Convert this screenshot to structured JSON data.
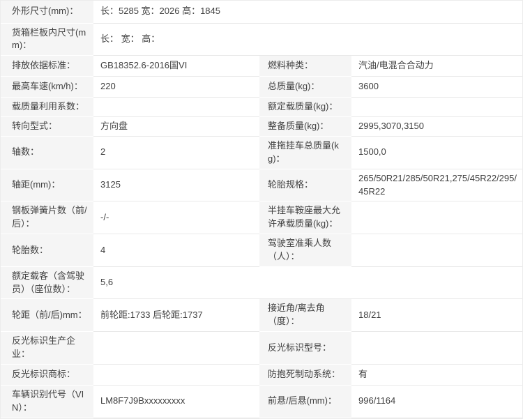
{
  "colors": {
    "label_bg": "#f5f5f5",
    "row_border": "#e9e9e9",
    "label_divider": "#ffffff",
    "text": "#404040",
    "page_bg": "#ffffff",
    "outer_border": "#ececec"
  },
  "table": {
    "name": "vehicle-specification-table",
    "rows": [
      {
        "kind": "full",
        "label": "外形尺寸(mm)：",
        "value": "长：5285 宽：2026 高：1845"
      },
      {
        "kind": "full",
        "label": "货箱栏板内尺寸(mm)：",
        "value": "长： 宽： 高："
      },
      {
        "kind": "split",
        "l_label": "排放依据标准：",
        "l_value": "GB18352.6-2016国VI",
        "r_label": "燃料种类：",
        "r_value": "汽油/电混合合动力"
      },
      {
        "kind": "split",
        "l_label": "最高车速(km/h)：",
        "l_value": "220",
        "r_label": "总质量(kg)：",
        "r_value": "3600"
      },
      {
        "kind": "split",
        "l_label": "载质量利用系数：",
        "l_value": "",
        "r_label": "额定载质量(kg)：",
        "r_value": ""
      },
      {
        "kind": "split",
        "l_label": "转向型式：",
        "l_value": "方向盘",
        "r_label": "整备质量(kg)：",
        "r_value": "2995,3070,3150"
      },
      {
        "kind": "split",
        "l_label": "轴数：",
        "l_value": "2",
        "r_label": "准拖挂车总质量(kg)：",
        "r_value": "1500,0"
      },
      {
        "kind": "split",
        "l_label": "轴距(mm)：",
        "l_value": "3125",
        "r_label": "轮胎规格：",
        "r_value": "265/50R21/285/50R21,275/45R22/295/45R22"
      },
      {
        "kind": "split",
        "l_label": "钢板弹簧片数（前/后）：",
        "l_value": "-/-",
        "r_label": "半挂车鞍座最大允许承载质量(kg)：",
        "r_value": ""
      },
      {
        "kind": "split",
        "l_label": "轮胎数：",
        "l_value": "4",
        "r_label": "驾驶室准乘人数（人）：",
        "r_value": ""
      },
      {
        "kind": "full",
        "label": "额定载客（含驾驶员）（座位数）：",
        "value": "5,6"
      },
      {
        "kind": "split",
        "l_label": "轮距（前/后)mm：",
        "l_value": "前轮距:1733 后轮距:1737",
        "r_label": "接近角/离去角（度）：",
        "r_value": "18/21"
      },
      {
        "kind": "split",
        "l_label": "反光标识生产企业：",
        "l_value": "",
        "r_label": "反光标识型号：",
        "r_value": ""
      },
      {
        "kind": "split",
        "l_label": "反光标识商标：",
        "l_value": "",
        "r_label": "防抱死制动系统：",
        "r_value": "有"
      },
      {
        "kind": "split",
        "l_label": "车辆识别代号（VIN）：",
        "l_value": "LM8F7J9Bxxxxxxxxx",
        "r_label": "前悬/后悬(mm)：",
        "r_value": "996/1164"
      }
    ]
  }
}
